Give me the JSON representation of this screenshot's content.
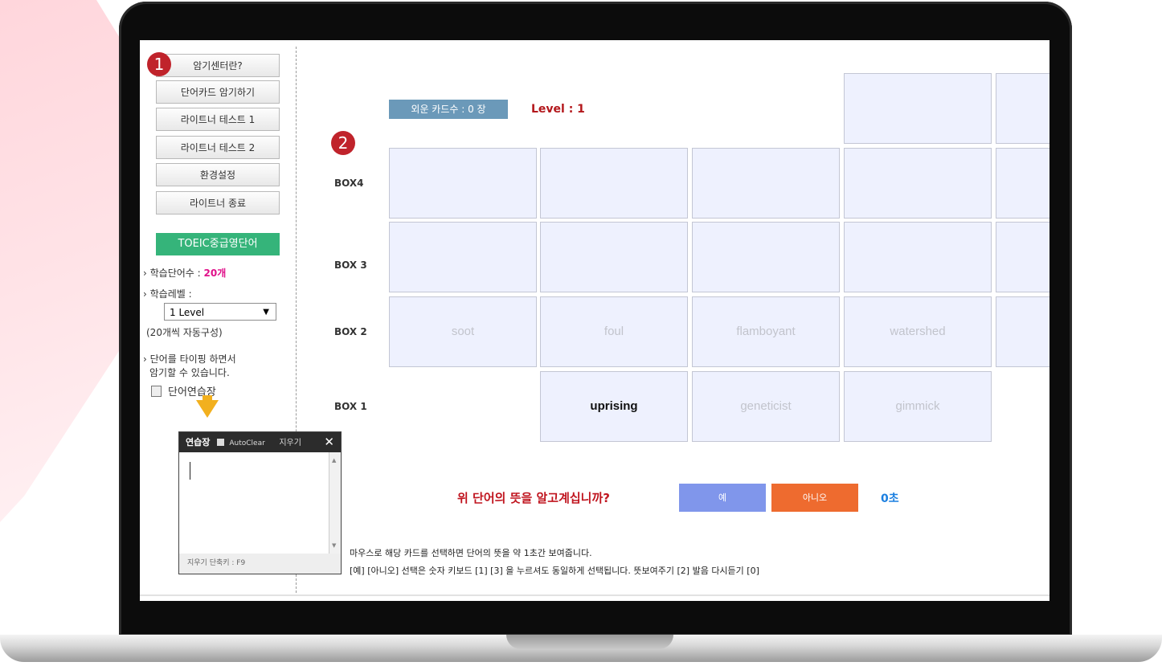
{
  "menu": {
    "items": [
      "암기센터란?",
      "단어카드 암기하기",
      "라이트너 테스트 1",
      "라이트너 테스트 2",
      "환경설정",
      "라이트너 종료"
    ]
  },
  "badges": {
    "one": "1",
    "two": "2"
  },
  "sidebar": {
    "category": "TOEIC중급영단어",
    "study_count_label": "학습단어수 :",
    "study_count_value": "20개",
    "level_label": "학습레벨 :",
    "level_value": "1 Level",
    "auto_note": "(20개씩 자동구성)",
    "typing_note_line1": "단어를 타이핑 하면서",
    "typing_note_line2": "암기할 수 있습니다.",
    "practice_link": "단어연습장"
  },
  "practice_pad": {
    "title": "연습장",
    "autoclear": "AutoClear",
    "clear": "지우기",
    "close": "✕",
    "shortcut": "지우기 단축키 : F9"
  },
  "board": {
    "learned_count": "외운 카드수 : 0 장",
    "level": "Level : 1",
    "box_labels": {
      "box4": "BOX4",
      "box3": "BOX 3",
      "box2": "BOX 2",
      "box1": "BOX 1"
    },
    "box2_cards": [
      "soot",
      "foul",
      "flamboyant",
      "watershed"
    ],
    "box1_cards": [
      "uprising",
      "geneticist",
      "gimmick"
    ]
  },
  "prompt": {
    "question": "위 단어의 뜻을 알고계십니까?",
    "yes": "예",
    "no": "아니오",
    "timer": "0초"
  },
  "instructions": {
    "line1": "마우스로 해당 카드를 선택하면 단어의 뜻을 약 1초간 보여줍니다.",
    "line2": "[예] [아니오] 선택은 숫자 키보드 [1] [3] 을 누르셔도 동일하게 선택됩니다. 뜻보여주기 [2] 발음 다시듣기 [0]"
  },
  "colors": {
    "accent_red": "#c0232b",
    "category_green": "#35b47a",
    "yes_blue": "#8096eb",
    "no_orange": "#ee6b2f",
    "card_bg": "#eef1fe"
  }
}
